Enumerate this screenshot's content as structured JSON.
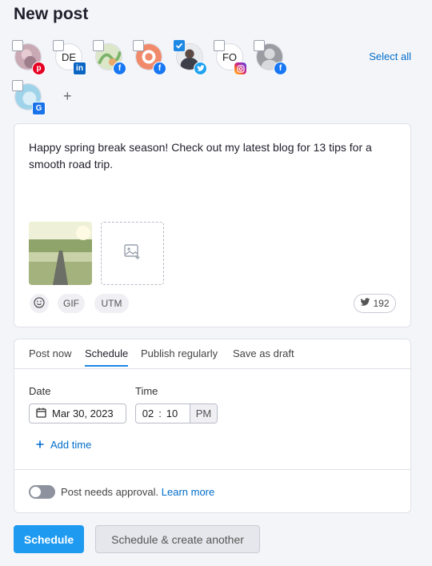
{
  "page": {
    "title": "New post"
  },
  "profiles": [
    {
      "initials": "",
      "network": "pinterest",
      "checked": false,
      "badge_text": "p"
    },
    {
      "initials": "DE",
      "network": "linkedin",
      "checked": false,
      "badge_text": "in"
    },
    {
      "initials": "",
      "network": "facebook",
      "checked": false,
      "badge_text": "f"
    },
    {
      "initials": "",
      "network": "facebook",
      "checked": false,
      "badge_text": "f"
    },
    {
      "initials": "",
      "network": "twitter",
      "checked": true,
      "badge_text": ""
    },
    {
      "initials": "FO",
      "network": "instagram",
      "checked": false,
      "badge_text": ""
    },
    {
      "initials": "",
      "network": "facebook",
      "checked": false,
      "badge_text": "f"
    },
    {
      "initials": "",
      "network": "google-business",
      "checked": false,
      "badge_text": "G"
    }
  ],
  "profiles_bar": {
    "select_all": "Select all",
    "add_symbol": "+"
  },
  "composer": {
    "text": "Happy spring break season! Check out my latest blog for 13 tips for a smooth road trip.",
    "tools": {
      "gif": "GIF",
      "utm": "UTM"
    },
    "char_count": "192"
  },
  "schedule": {
    "tabs": [
      {
        "label": "Post now",
        "active": false
      },
      {
        "label": "Schedule",
        "active": true
      },
      {
        "label": "Publish regularly",
        "active": false
      },
      {
        "label": "Save as draft",
        "active": false
      }
    ],
    "date_label": "Date",
    "date_value": "Mar 30, 2023",
    "time_label": "Time",
    "hour": "02",
    "minute": "10",
    "ampm": "PM",
    "add_time": "Add time",
    "approval_text": "Post needs approval.",
    "learn_more": "Learn more"
  },
  "actions": {
    "schedule": "Schedule",
    "schedule_another": "Schedule & create another"
  },
  "colors": {
    "accent": "#1e9af1",
    "link": "#006dca"
  }
}
